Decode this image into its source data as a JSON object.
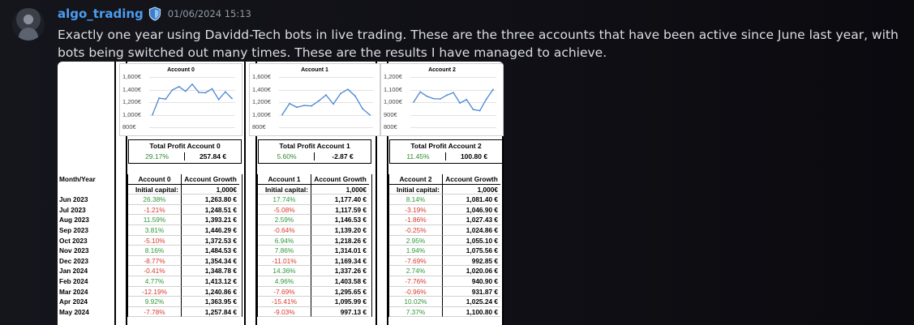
{
  "message": {
    "username": "algo_trading",
    "timestamp": "01/06/2024 15:13",
    "text": "Exactly one year using Davidd-Tech bots in live trading. These are the three accounts that have been active since June last year, with bots being switched out many times. These are the results I have managed to achieve.",
    "colors": {
      "username": "#4b9df0",
      "positive": "#2e9a3a",
      "negative": "#d83a2e"
    }
  },
  "sheet": {
    "month_header": "Month/Year",
    "months": [
      "Jun 2023",
      "Jul 2023",
      "Aug 2023",
      "Sep 2023",
      "Oct 2023",
      "Nov 2023",
      "Dec 2023",
      "Jan 2024",
      "Feb 2024",
      "Mar 2024",
      "Apr 2024",
      "May 2024"
    ],
    "accounts": [
      {
        "chart_title": "Account 0",
        "yticks": [
          "1,600€",
          "1,400€",
          "1,200€",
          "1,000€",
          "800€"
        ],
        "profit_title": "Total Profit Account 0",
        "profit_pct": "29.17%",
        "profit_amt": "257.84 €",
        "col_account": "Account 0",
        "col_growth": "Account Growth",
        "initial_label": "Initial capital:",
        "initial_value": "1,000€",
        "pcts": [
          "26.38%",
          "-1.21%",
          "11.59%",
          "3.81%",
          "-5.10%",
          "8.16%",
          "-8.77%",
          "-0.41%",
          "4.77%",
          "-12.19%",
          "9.92%",
          "-7.78%"
        ],
        "growth": [
          "1,263.80 €",
          "1,248.51 €",
          "1,393.21 €",
          "1,446.29 €",
          "1,372.53 €",
          "1,484.53 €",
          "1,354.34 €",
          "1,348.78 €",
          "1,413.12 €",
          "1,240.86 €",
          "1,363.95 €",
          "1,257.84 €"
        ]
      },
      {
        "chart_title": "Account 1",
        "yticks": [
          "1,600€",
          "1,400€",
          "1,200€",
          "1,000€",
          "800€"
        ],
        "profit_title": "Total Profit Account 1",
        "profit_pct": "5.60%",
        "profit_amt": "-2.87 €",
        "col_account": "Account 1",
        "col_growth": "Account Growth",
        "initial_label": "Initial capital:",
        "initial_value": "1,000€",
        "pcts": [
          "17.74%",
          "-5.08%",
          "2.59%",
          "-0.64%",
          "6.94%",
          "7.86%",
          "-11.01%",
          "14.36%",
          "4.96%",
          "-7.69%",
          "-15.41%",
          "-9.03%"
        ],
        "growth": [
          "1,177.40 €",
          "1,117.59 €",
          "1,146.53 €",
          "1,139.20 €",
          "1,218.26 €",
          "1,314.01 €",
          "1,169.34 €",
          "1,337.26 €",
          "1,403.58 €",
          "1,295.65 €",
          "1,095.99 €",
          "997.13 €"
        ]
      },
      {
        "chart_title": "Account 2",
        "yticks": [
          "1,200€",
          "1,100€",
          "1,000€",
          "900€",
          "800€"
        ],
        "profit_title": "Total Profit Account 2",
        "profit_pct": "11.45%",
        "profit_amt": "100.80 €",
        "col_account": "Account 2",
        "col_growth": "Account Growth",
        "initial_label": "Initial capital:",
        "initial_value": "1,000€",
        "pcts": [
          "8.14%",
          "-3.19%",
          "-1.86%",
          "-0.25%",
          "2.95%",
          "1.94%",
          "-7.69%",
          "2.74%",
          "-7.76%",
          "-0.96%",
          "10.02%",
          "7.37%"
        ],
        "growth": [
          "1,081.40 €",
          "1,046.90 €",
          "1,027.43 €",
          "1,024.86 €",
          "1,055.10 €",
          "1,075.56 €",
          "992.85 €",
          "1,020.06 €",
          "940.90 €",
          "931.87 €",
          "1,025.24 €",
          "1,100.80 €"
        ]
      }
    ]
  },
  "chart_data": [
    {
      "type": "line",
      "title": "Account 0",
      "ylim": [
        800,
        1600
      ],
      "values": [
        1000,
        1263.8,
        1248.51,
        1393.21,
        1446.29,
        1372.53,
        1484.53,
        1354.34,
        1348.78,
        1413.12,
        1240.86,
        1363.95,
        1257.84
      ]
    },
    {
      "type": "line",
      "title": "Account 1",
      "ylim": [
        800,
        1600
      ],
      "values": [
        1000,
        1177.4,
        1117.59,
        1146.53,
        1139.2,
        1218.26,
        1314.01,
        1169.34,
        1337.26,
        1403.58,
        1295.65,
        1095.99,
        997.13
      ]
    },
    {
      "type": "line",
      "title": "Account 2",
      "ylim": [
        800,
        1200
      ],
      "values": [
        1000,
        1081.4,
        1046.9,
        1027.43,
        1024.86,
        1055.1,
        1075.56,
        992.85,
        1020.06,
        940.9,
        931.87,
        1025.24,
        1100.8
      ]
    }
  ]
}
